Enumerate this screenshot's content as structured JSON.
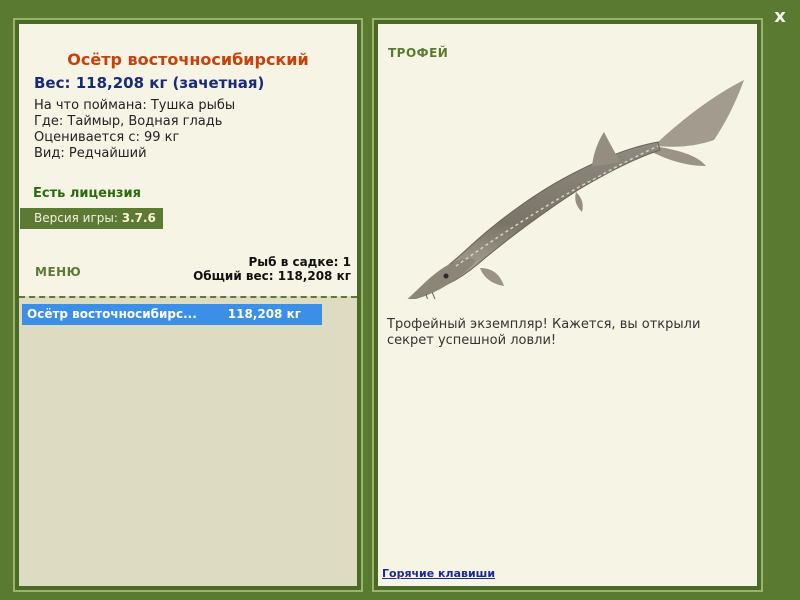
{
  "close": {
    "label": "x"
  },
  "left": {
    "title": "Осётр восточносибирский",
    "weight": "Вес: 118,208 кг (зачетная)",
    "details": [
      "На что поймана: Тушка рыбы",
      "Где: Таймыр, Водная гладь",
      "Оценивается с: 99 кг",
      "Вид: Редчайший"
    ],
    "license": "Есть лицензия",
    "version_label": "Версия игры: ",
    "version_value": "3.7.6",
    "menu": "МЕНЮ",
    "fish_count": "Рыб в садке: 1",
    "total_weight": "Общий вес: 118,208 кг",
    "catch_list": [
      {
        "name": "Осётр восточносибирс...",
        "weight": "118,208 кг"
      }
    ]
  },
  "right": {
    "trophy": "ТРОФЕЙ",
    "description": "Трофейный экземпляр! Кажется, вы открыли секрет успешной ловли!",
    "hotkeys": "Горячие клавиши"
  },
  "colors": {
    "frame": "#5a7a32",
    "panel_bg": "#f6f4e4",
    "title": "#c8400a",
    "selection": "#3c8fe6"
  }
}
